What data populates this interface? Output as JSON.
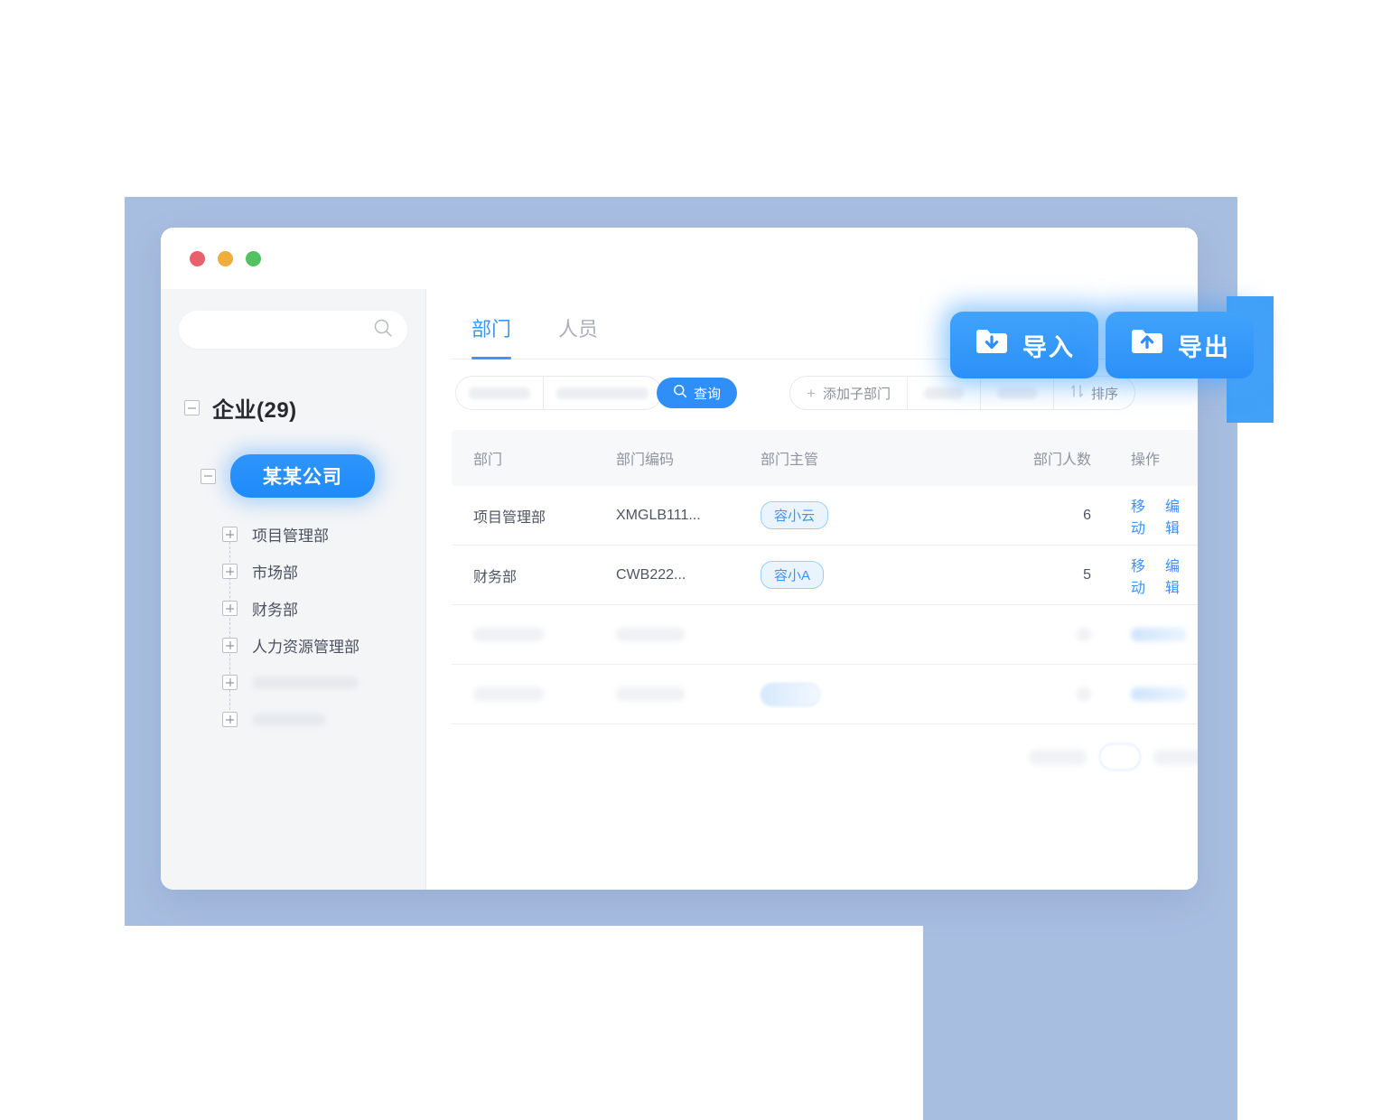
{
  "window": {
    "traffic_lights": [
      "close",
      "minimize",
      "maximize"
    ]
  },
  "sidebar": {
    "search": {
      "value": "",
      "placeholder": "",
      "icon": "search-icon"
    },
    "tree": {
      "root": {
        "label": "企业(29)",
        "expander": "minus"
      },
      "company": {
        "label": "某某公司",
        "expander": "minus",
        "selected": true
      },
      "children": [
        {
          "label": "项目管理部",
          "expander": "plus",
          "blurred": false
        },
        {
          "label": "市场部",
          "expander": "plus",
          "blurred": false
        },
        {
          "label": "财务部",
          "expander": "plus",
          "blurred": false
        },
        {
          "label": "人力资源管理部",
          "expander": "plus",
          "blurred": false
        },
        {
          "label": "",
          "expander": "plus",
          "blurred": true
        },
        {
          "label": "",
          "expander": "plus",
          "blurred": true
        }
      ]
    }
  },
  "main": {
    "tabs": [
      {
        "label": "部门",
        "active": true
      },
      {
        "label": "人员",
        "active": false
      }
    ],
    "toolbar": {
      "query_label": "查询",
      "query_icon": "search-icon",
      "add_sub_dept_label": "添加子部门",
      "add_icon": "plus-icon",
      "sort_label": "排序",
      "sort_icon": "sort-icon"
    },
    "table": {
      "columns": [
        "部门",
        "部门编码",
        "部门主管",
        "部门人数",
        "操作"
      ],
      "rows": [
        {
          "dept": "项目管理部",
          "code": "XMGLB111...",
          "manager": "容小云",
          "count": "6",
          "actions": [
            "移动",
            "编辑"
          ],
          "delete_icon": "trash-icon",
          "blurred": false
        },
        {
          "dept": "财务部",
          "code": "CWB222...",
          "manager": "容小A",
          "count": "5",
          "actions": [
            "移动",
            "编辑"
          ],
          "delete_icon": "trash-icon",
          "blurred": false
        },
        {
          "dept": "",
          "code": "",
          "manager": "",
          "count": "",
          "actions": [],
          "delete_icon": "trash-icon",
          "blurred": true,
          "has_manager_badge": false
        },
        {
          "dept": "",
          "code": "",
          "manager": "",
          "count": "",
          "actions": [],
          "delete_icon": "trash-icon",
          "blurred": true,
          "has_manager_badge": true
        }
      ]
    }
  },
  "floating": {
    "import": {
      "label": "导入",
      "icon": "folder-download-icon"
    },
    "export": {
      "label": "导出",
      "icon": "folder-upload-icon"
    }
  },
  "colors": {
    "accent": "#2f8ef7",
    "accent_light": "#41a3fb",
    "backdrop": "#a8bee1",
    "sidebar_bg": "#f4f5f7",
    "table_header_bg": "#f7f8fa",
    "text_primary": "#4e5664",
    "text_muted": "#8d939f",
    "dot_red": "#e8606b",
    "dot_yellow": "#efad3d",
    "dot_green": "#52c261"
  }
}
